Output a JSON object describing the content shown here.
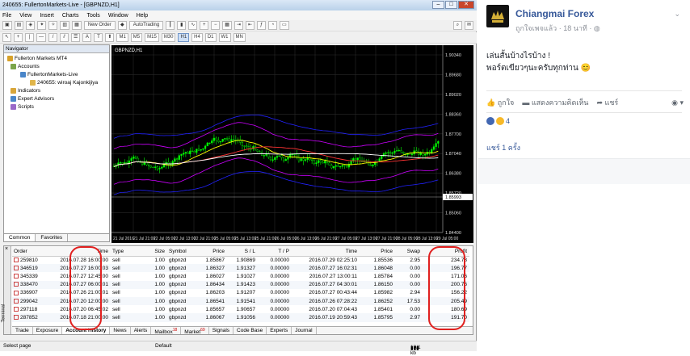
{
  "mt4": {
    "title": "240655: FullertonMarkets-Live - [GBPNZD,H1]",
    "menu": [
      "File",
      "View",
      "Insert",
      "Charts",
      "Tools",
      "Window",
      "Help"
    ],
    "toolbar1": {
      "new_order": "New Order",
      "autotrading": "AutoTrading"
    },
    "timeframes": [
      "M1",
      "M5",
      "M15",
      "M30",
      "H1",
      "H4",
      "D1",
      "W1",
      "MN"
    ],
    "active_timeframe": "H1",
    "navigator": {
      "title": "Navigator",
      "root": "Fullerton Markets MT4",
      "accounts": "Accounts",
      "server": "FullertonMarkets-Live",
      "account": "240655: wiroaj Kajonkijiya",
      "indicators": "Indicators",
      "experts": "Expert Advisors",
      "scripts": "Scripts",
      "tabs": [
        "Common",
        "Favorites"
      ]
    },
    "chart": {
      "symbol_label": "GBPNZD,H1",
      "price_labels": [
        "1.90340",
        "1.89680",
        "1.89020",
        "1.88360",
        "1.87700",
        "1.87040",
        "1.86380",
        "1.85720",
        "1.85060",
        "1.84400"
      ],
      "current_price": "1.85993",
      "time_labels": [
        "21 Jul 2016",
        "21 Jul 21:00",
        "22 Jul 05:00",
        "22 Jul 13:00",
        "22 Jul 21:00",
        "25 Jul 05:00",
        "25 Jul 13:00",
        "25 Jul 21:00",
        "26 Jul 05:00",
        "26 Jul 13:00",
        "26 Jul 21:00",
        "27 Jul 05:00",
        "27 Jul 13:00",
        "27 Jul 21:00",
        "28 Jul 05:00",
        "28 Jul 13:00",
        "29 Jul 05:00"
      ]
    },
    "history": {
      "headers": [
        "Order",
        "Time",
        "Type",
        "Size",
        "Symbol",
        "Price",
        "S / L",
        "T / P",
        "Time",
        "Price",
        "Swap",
        "Profit"
      ],
      "rows": [
        [
          "259810",
          "2016.07.28 16:00:00",
          "sell",
          "1.00",
          "gbpnzd",
          "1.85867",
          "1.90869",
          "0.00000",
          "2016.07.29 02:25:10",
          "1.85536",
          "2.95",
          "234.78"
        ],
        [
          "346519",
          "2016.07.27 16:00:03",
          "sell",
          "1.00",
          "gbpnzd",
          "1.86327",
          "1.91327",
          "0.00000",
          "2016.07.27 16:02:31",
          "1.86048",
          "0.00",
          "196.77"
        ],
        [
          "345339",
          "2016.07.27 12:45:00",
          "sell",
          "1.00",
          "gbpnzd",
          "1.86027",
          "1.91027",
          "0.00000",
          "2016.07.27 13:00:11",
          "1.85784",
          "0.00",
          "171.06"
        ],
        [
          "338470",
          "2016.07.27 06:00:01",
          "sell",
          "1.00",
          "gbpnzd",
          "1.86434",
          "1.91423",
          "0.00000",
          "2016.07.27 04:30:01",
          "1.86150",
          "0.00",
          "200.76"
        ],
        [
          "336907",
          "2016.07.26 21:00:01",
          "sell",
          "1.00",
          "gbpnzd",
          "1.86203",
          "1.91207",
          "0.00000",
          "2016.07.27 00:43:44",
          "1.85982",
          "2.94",
          "156.22"
        ],
        [
          "299042",
          "2016.07.20 12:00:00",
          "sell",
          "1.00",
          "gbpnzd",
          "1.86541",
          "1.91541",
          "0.00000",
          "2016.07.26 07:28:22",
          "1.86252",
          "17.53",
          "205.49"
        ],
        [
          "297118",
          "2016.07.20 06:45:02",
          "sell",
          "1.00",
          "gbpnzd",
          "1.85657",
          "1.90657",
          "0.00000",
          "2016.07.20 07:04:43",
          "1.85401",
          "0.00",
          "180.69"
        ],
        [
          "287852",
          "2016.07.18 21:00:00",
          "sell",
          "1.00",
          "gbpnzd",
          "1.86067",
          "1.91056",
          "0.00000",
          "2016.07.19 20:59:43",
          "1.85795",
          "2.97",
          "191.70"
        ]
      ]
    },
    "terminal_tabs": [
      "Trade",
      "Exposure",
      "Account History",
      "News",
      "Alerts",
      "Mailbox",
      "Market",
      "Signals",
      "Code Base",
      "Experts",
      "Journal"
    ],
    "mailbox_badge": "18",
    "market_badge": "69",
    "terminal_label": "Terminal",
    "status": {
      "left": "Select page",
      "middle": "Default",
      "right": "10/1 kb"
    }
  },
  "facebook": {
    "page_name": "Chiangmai Forex",
    "meta": "ถูกใจเพจแล้ว · 18 นาที · ",
    "post_lines": [
      "เล่นสั้นบ้างไรบ้าง !",
      "พอร์ตเขียวๆนะครับทุกท่าน 😊"
    ],
    "actions": {
      "like": "ถูกใจ",
      "comment": "แสดงความคิดเห็น",
      "share": "แชร์"
    },
    "reaction_count": "4",
    "shares": "แชร์ 1 ครั้ง",
    "colors": {
      "link": "#365899",
      "like_react": "#4267b2",
      "wow_react": "#f7b928"
    }
  }
}
